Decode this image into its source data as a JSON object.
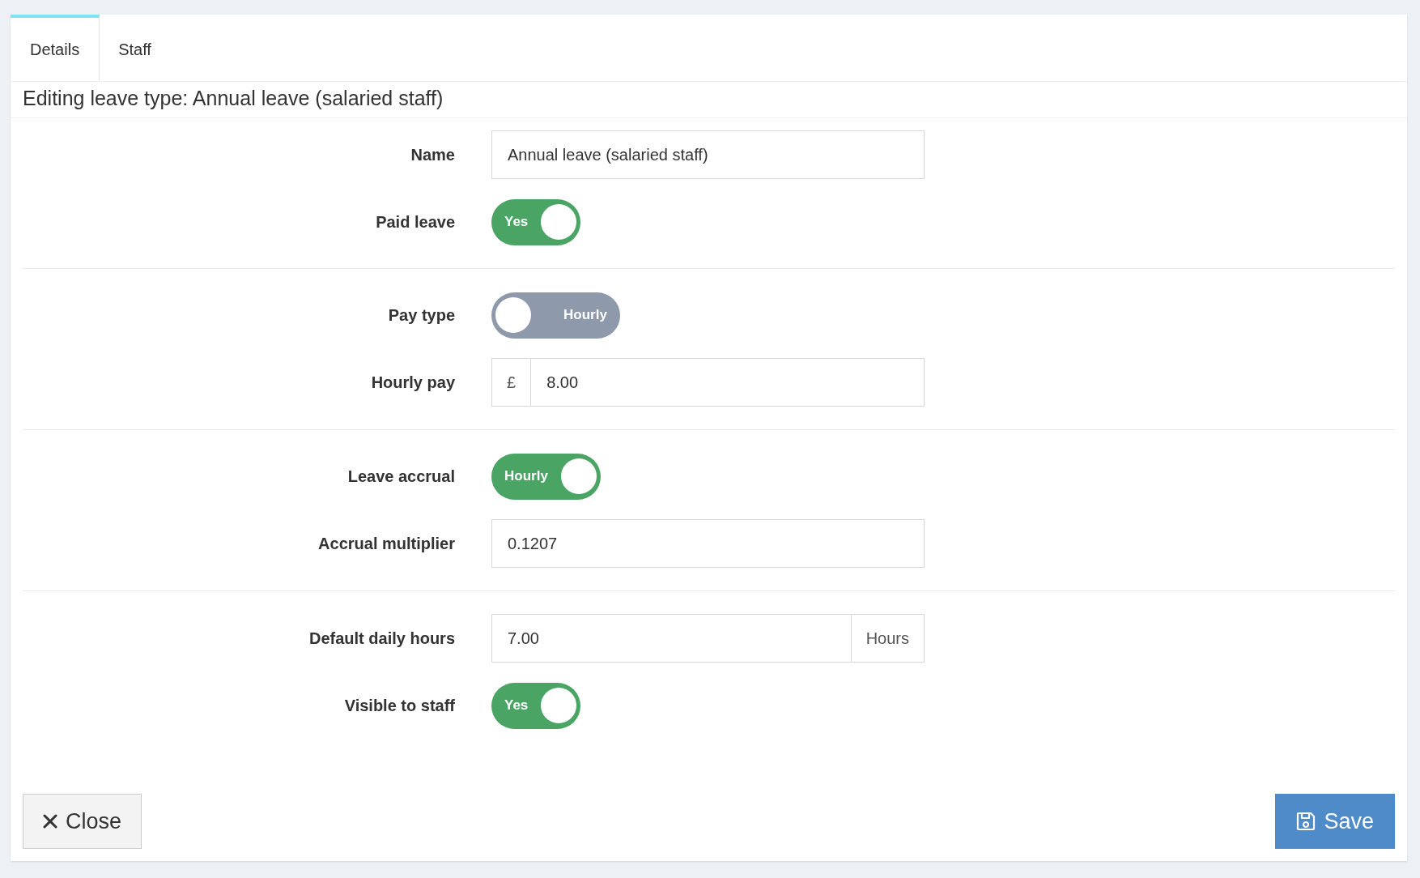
{
  "tabs": [
    {
      "label": "Details",
      "selected": true
    },
    {
      "label": "Staff",
      "selected": false
    }
  ],
  "heading": "Editing leave type: Annual leave (salaried staff)",
  "sections": [
    {
      "rows": [
        {
          "label": "Name",
          "kind": "text",
          "value": "Annual leave (salaried staff)"
        },
        {
          "label": "Paid leave",
          "kind": "toggle",
          "on": true,
          "text": "Yes"
        }
      ]
    },
    {
      "rows": [
        {
          "label": "Pay type",
          "kind": "toggle",
          "on": false,
          "text": "Hourly"
        },
        {
          "label": "Hourly pay",
          "kind": "prefix",
          "addon": "£",
          "value": "8.00"
        }
      ]
    },
    {
      "rows": [
        {
          "label": "Leave accrual",
          "kind": "toggle",
          "on": true,
          "text": "Hourly"
        },
        {
          "label": "Accrual multiplier",
          "kind": "text",
          "value": "0.1207"
        }
      ]
    },
    {
      "rows": [
        {
          "label": "Default daily hours",
          "kind": "suffix",
          "addon": "Hours",
          "value": "7.00"
        },
        {
          "label": "Visible to staff",
          "kind": "toggle",
          "on": true,
          "text": "Yes"
        }
      ]
    }
  ],
  "buttons": {
    "close": "Close",
    "save": "Save"
  }
}
